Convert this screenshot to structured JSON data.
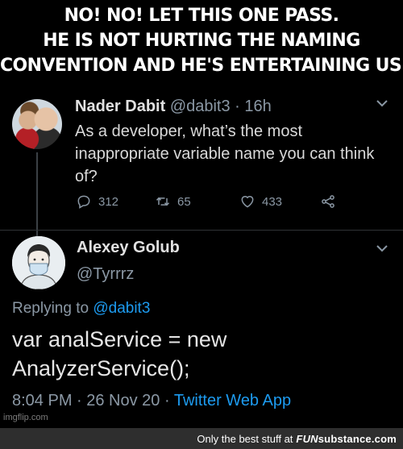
{
  "caption": {
    "lines": [
      "NO! NO! LET THIS ONE PASS.",
      "HE IS NOT HURTING THE NAMING",
      "CONVENTION AND HE'S ENTERTAINING US!"
    ]
  },
  "tweet1": {
    "name": "Nader Dabit",
    "handle": "@dabit3",
    "time": "· 16h",
    "text": "As a developer, what’s the most inappropriate variable name you can think of?",
    "replies": "312",
    "retweets": "65",
    "likes": "433"
  },
  "tweet2": {
    "name": "Alexey Golub",
    "handle": "@Tyrrrz",
    "replying_prefix": "Replying to ",
    "replying_handle": "@dabit3",
    "code_line1": "var analService = new",
    "code_line2": "AnalyzerService();",
    "timestamp": "8:04 PM · 26 Nov 20 · ",
    "source": "Twitter Web App"
  },
  "watermark": "imgflip.com",
  "footer": {
    "tagline": "Only the best stuff at",
    "brand_fun": "FUN",
    "brand_rest": "substance.com"
  },
  "colors": {
    "background": "#000000",
    "accent_blue": "#1d9bf0",
    "secondary_text": "#8b98a5"
  }
}
